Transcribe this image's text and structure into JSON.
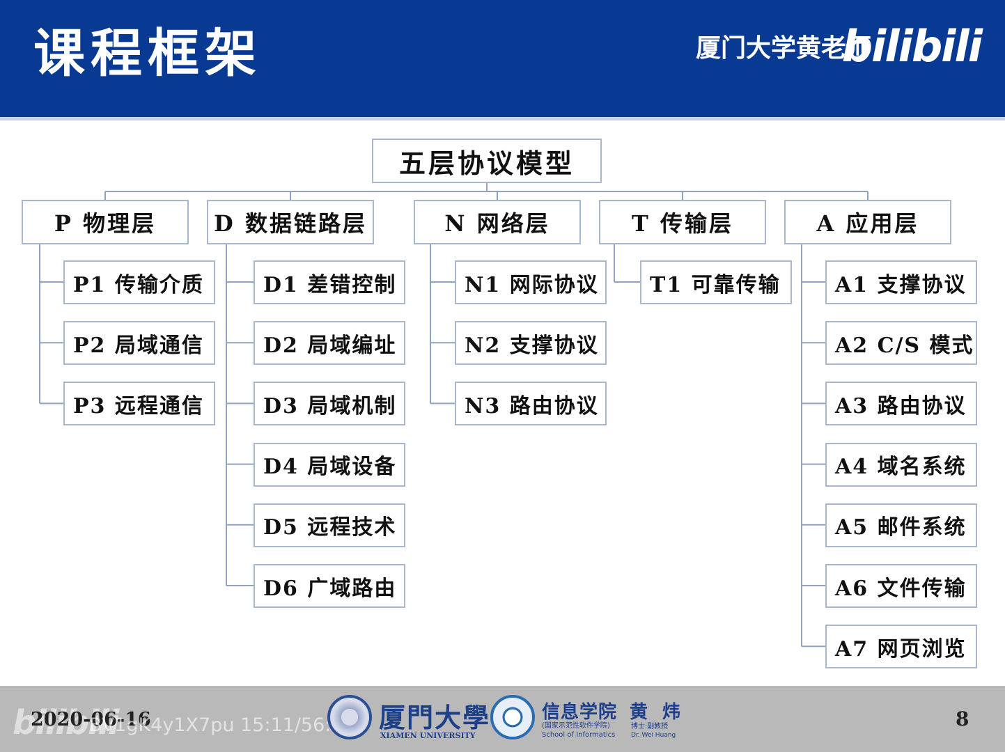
{
  "header": {
    "title": "课程框架",
    "author": "厦门大学黄老师",
    "logo_text": "bilibili"
  },
  "diagram": {
    "root": "五层协议模型",
    "layers": [
      {
        "label": "P 物理层",
        "items": [
          "P1 传输介质",
          "P2 局域通信",
          "P3 远程通信"
        ]
      },
      {
        "label": "D 数据链路层",
        "items": [
          "D1 差错控制",
          "D2 局域编址",
          "D3 局域机制",
          "D4 局域设备",
          "D5 远程技术",
          "D6 广域路由"
        ]
      },
      {
        "label": "N 网络层",
        "items": [
          "N1 网际协议",
          "N2 支撑协议",
          "N3 路由协议"
        ]
      },
      {
        "label": "T 传输层",
        "items": [
          "T1 可靠传输"
        ]
      },
      {
        "label": "A 应用层",
        "items": [
          "A1 支撑协议",
          "A2 C/S 模式",
          "A3 路由协议",
          "A4 域名系统",
          "A5 邮件系统",
          "A6 文件传输",
          "A7 网页浏览"
        ]
      }
    ]
  },
  "footer": {
    "date": "2020-06-16",
    "watermark_logo": "bilibili",
    "watermark_text": "BV1gK4y1X7pu 15:11/56:54",
    "university_cn": "厦門大學",
    "university_en": "XIAMEN UNIVERSITY",
    "school_cn": "信息学院",
    "school_sub": "(国家示范性软件学院)",
    "school_en": "School of Informatics",
    "professor_cn": "黄 炜",
    "professor_title": "博士·副教授",
    "professor_en": "Dr. Wei Huang",
    "page_number": "8"
  },
  "colors": {
    "header_bg": "#083a93",
    "box_border": "#a8b7cc",
    "connector": "#8fa3c0",
    "footer_bg": "#b9b9b9"
  }
}
